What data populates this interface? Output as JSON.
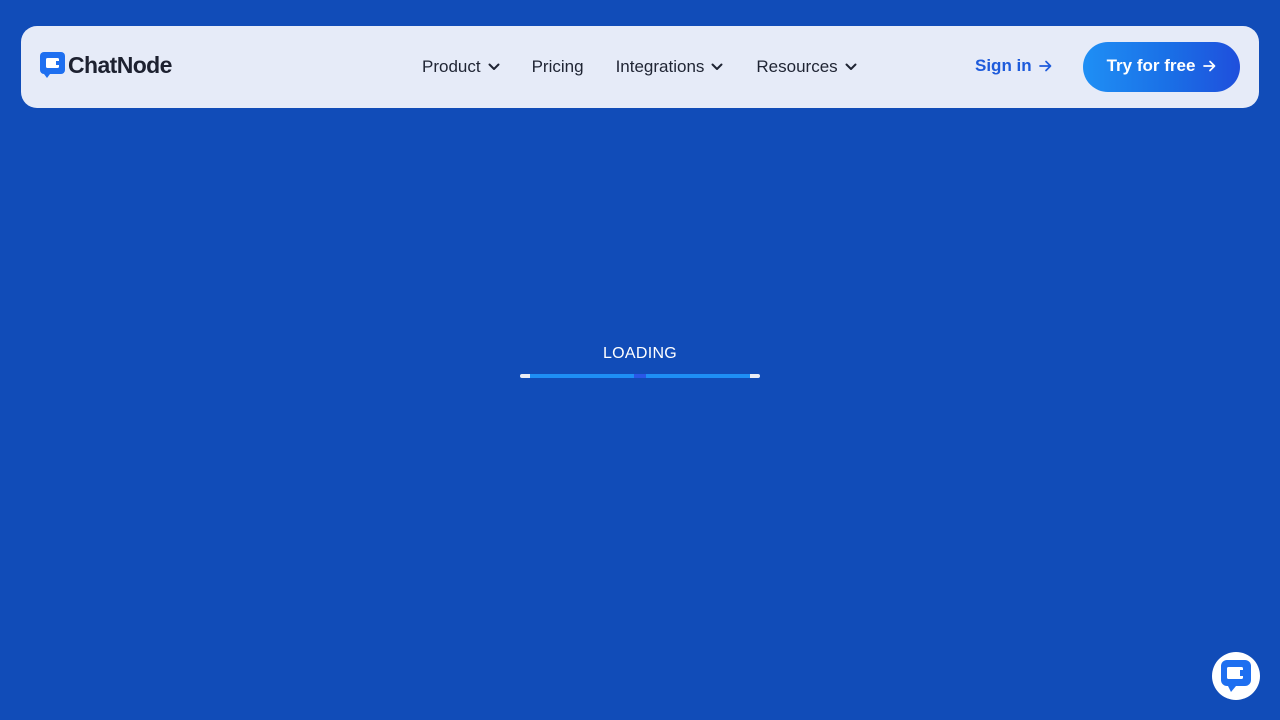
{
  "brand": {
    "name": "ChatNode",
    "color": "#1e6ff0"
  },
  "nav": {
    "items": [
      {
        "label": "Product",
        "icon": "chevron-down-icon"
      },
      {
        "label": "Pricing"
      },
      {
        "label": "Integrations",
        "icon": "chevron-down-icon"
      },
      {
        "label": "Resources",
        "icon": "chevron-down-icon"
      }
    ]
  },
  "auth": {
    "signin_label": "Sign in",
    "signin_icon": "arrow-right-icon",
    "cta_label": "Try for free",
    "cta_icon": "arrow-right-icon"
  },
  "loading": {
    "label": "LOADING"
  },
  "chat_widget": {
    "icon": "chat-icon"
  },
  "colors": {
    "page_background": "#114cb8",
    "navbar_background": "#e6ebf8",
    "accent": "#1e5bdb",
    "cta_gradient_start": "#1f8ff5",
    "cta_gradient_end": "#1f4fdc"
  }
}
